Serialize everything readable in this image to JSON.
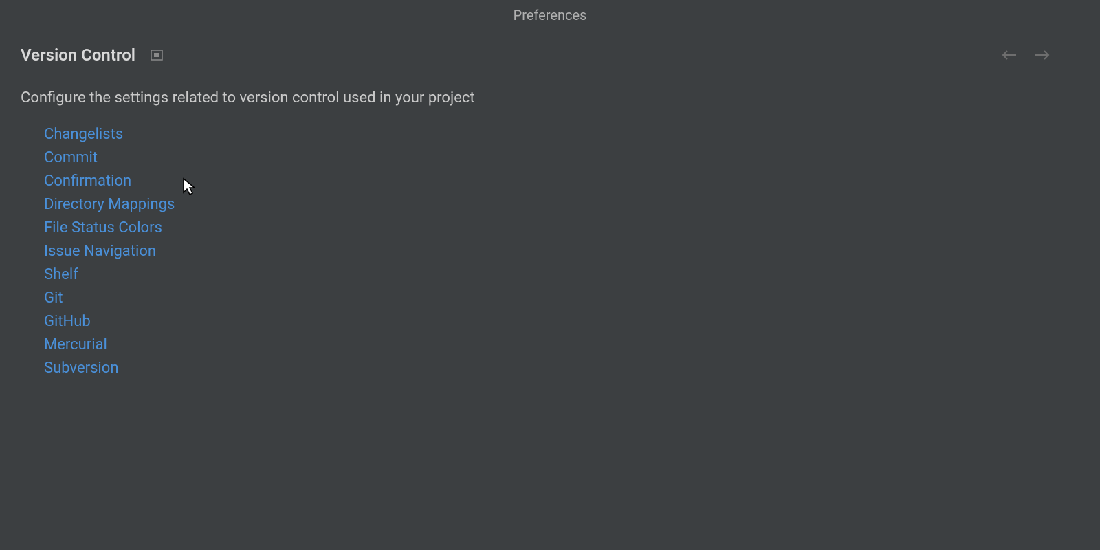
{
  "header": {
    "title": "Preferences"
  },
  "section": {
    "title": "Version Control",
    "description": "Configure the settings related to version control used in your project"
  },
  "links": [
    "Changelists",
    "Commit",
    "Confirmation",
    "Directory Mappings",
    "File Status Colors",
    "Issue Navigation",
    "Shelf",
    "Git",
    "GitHub",
    "Mercurial",
    "Subversion"
  ],
  "colors": {
    "background": "#3c3f41",
    "text": "#bbbbbb",
    "link": "#4a90d9",
    "border": "#2b2d2f"
  }
}
